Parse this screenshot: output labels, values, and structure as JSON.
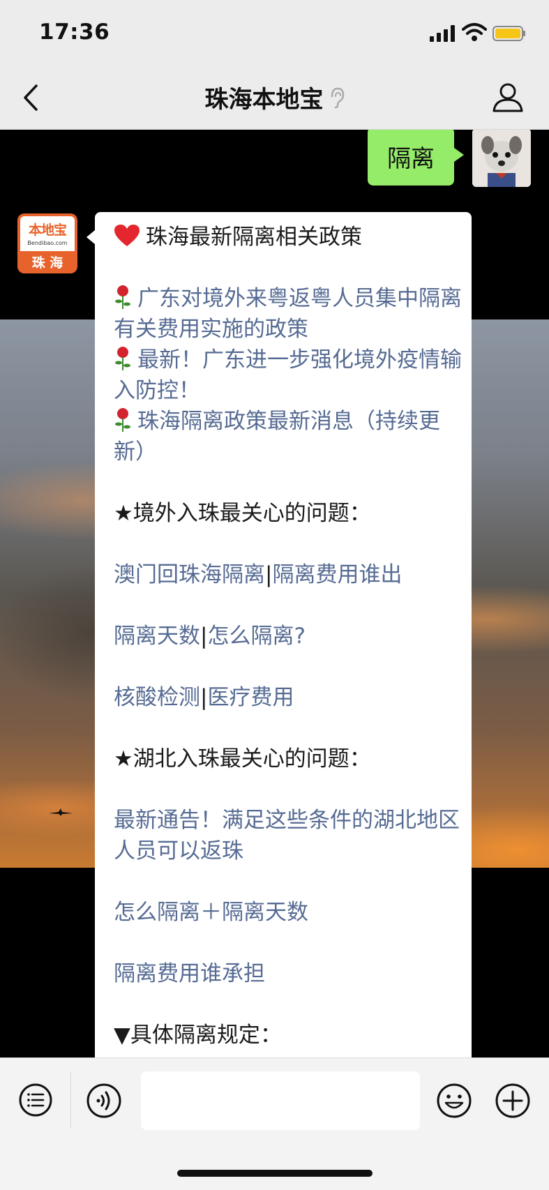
{
  "status_bar": {
    "time": "17:36"
  },
  "nav": {
    "title": "珠海本地宝"
  },
  "chat": {
    "my_message": "隔离",
    "bot_avatar": {
      "brand": "本地宝",
      "url": "Bendibao.com",
      "city": "珠 海"
    },
    "bot_message": {
      "heading": "珠海最新隔离相关政策",
      "news_links": [
        "广东对境外来粤返粤人员集中隔离有关费用实施的政策",
        "最新！广东进一步强化境外疫情输入防控！",
        "珠海隔离政策最新消息（持续更新）"
      ],
      "section1_title": "★境外入珠最关心的问题：",
      "section1_rows": [
        [
          "澳门回珠海隔离",
          "隔离费用谁出"
        ],
        [
          "隔离天数",
          "怎么隔离?"
        ],
        [
          "核酸检测",
          "医疗费用"
        ]
      ],
      "separator": "|",
      "section2_title": "★湖北入珠最关心的问题：",
      "section2_links": [
        "最新通告！满足这些条件的湖北地区人员可以返珠",
        "怎么隔离＋隔离天数",
        "隔离费用谁承担"
      ],
      "section3_title": "▼具体隔离规定："
    }
  },
  "colors": {
    "bubble_green": "#95ec69",
    "link_blue": "#566b93",
    "brand_orange": "#e8632b"
  },
  "icons": [
    "back-icon",
    "ear-icon",
    "user-icon",
    "list-icon",
    "voice-icon",
    "emoji-icon",
    "plus-icon",
    "heart-icon",
    "rose-icon"
  ]
}
